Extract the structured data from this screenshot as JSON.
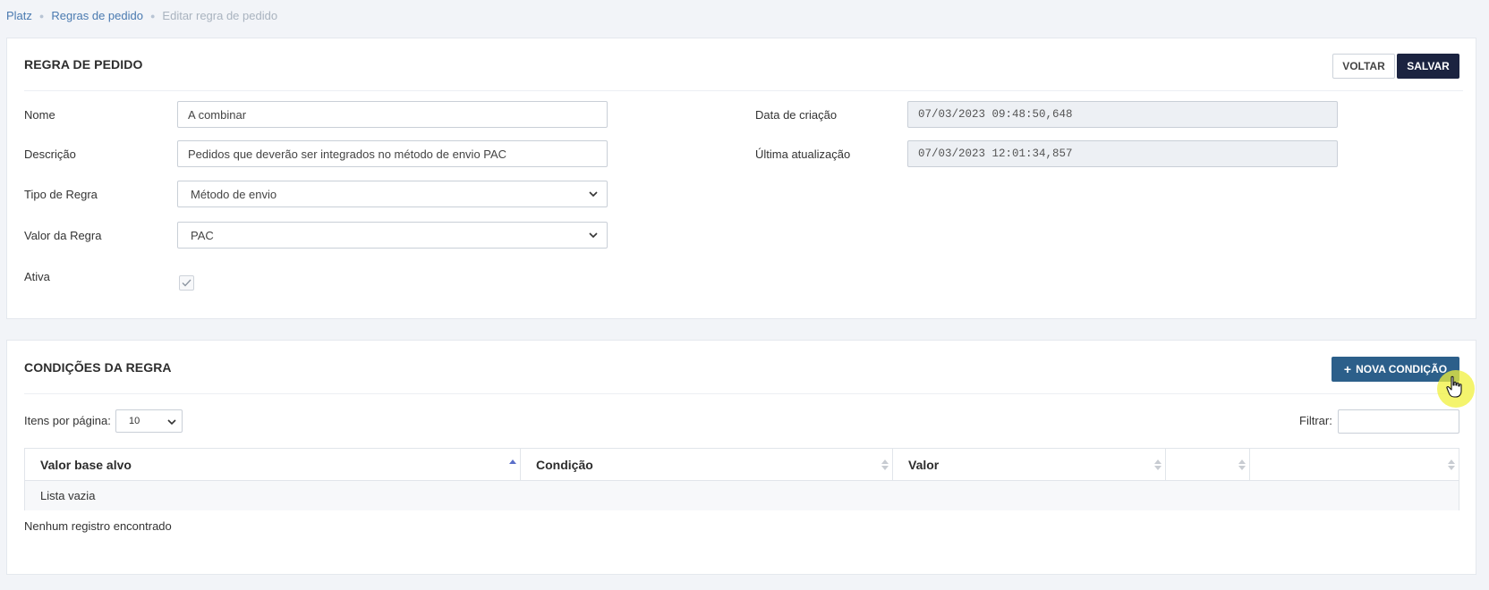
{
  "breadcrumb": {
    "items": [
      "Platz",
      "Regras de pedido"
    ],
    "current": "Editar regra de pedido"
  },
  "rule_panel": {
    "title": "REGRA DE PEDIDO",
    "back_label": "VOLTAR",
    "save_label": "SALVAR",
    "fields": {
      "name_label": "Nome",
      "name_value": "A combinar",
      "description_label": "Descrição",
      "description_value": "Pedidos que deverão ser integrados no método de envio PAC",
      "type_label": "Tipo de Regra",
      "type_value": "Método de envio",
      "rule_value_label": "Valor da Regra",
      "rule_value_value": "PAC",
      "active_label": "Ativa",
      "active_checked": true,
      "created_label": "Data de criação",
      "created_value": "07/03/2023 09:48:50,648",
      "updated_label": "Última atualização",
      "updated_value": "07/03/2023 12:01:34,857"
    }
  },
  "conditions_panel": {
    "title": "CONDIÇÕES DA REGRA",
    "new_condition_label": "NOVA CONDIÇÃO",
    "items_per_page_label": "Itens por página:",
    "items_per_page_value": "10",
    "filter_label": "Filtrar:",
    "table": {
      "columns": [
        "Valor base alvo",
        "Condição",
        "Valor",
        "",
        ""
      ],
      "empty_row": "Lista vazia"
    },
    "empty_message": "Nenhum registro encontrado"
  },
  "colors": {
    "save_button": "#1b2340",
    "new_condition_button": "#2c5f8a",
    "link": "#4a7ab0"
  }
}
